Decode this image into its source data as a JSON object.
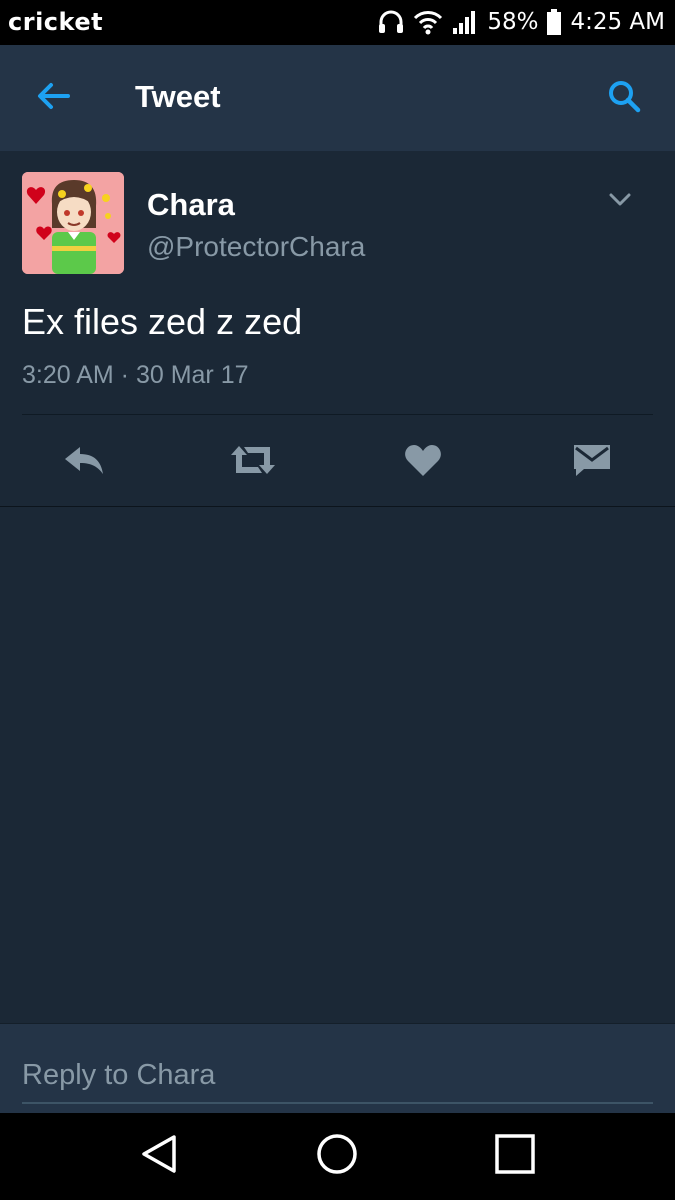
{
  "status_bar": {
    "carrier": "cricket",
    "battery": "58%",
    "time": "4:25 AM",
    "icons": [
      "headset-icon",
      "wifi-icon",
      "signal-icon",
      "battery-icon"
    ]
  },
  "app_bar": {
    "title": "Tweet",
    "back_icon": "back-arrow-icon",
    "search_icon": "search-icon"
  },
  "tweet": {
    "author_name": "Chara",
    "author_handle": "@ProtectorChara",
    "text": "Ex files zed z zed",
    "timestamp": "3:20 AM · 30 Mar 17",
    "actions": [
      "reply-icon",
      "retweet-icon",
      "like-icon",
      "direct-message-icon"
    ]
  },
  "reply": {
    "placeholder": "Reply to Chara",
    "value": ""
  },
  "colors": {
    "background": "#1b2836",
    "bar": "#243447",
    "accent": "#1da1f2",
    "secondary_text": "#8899a6"
  }
}
